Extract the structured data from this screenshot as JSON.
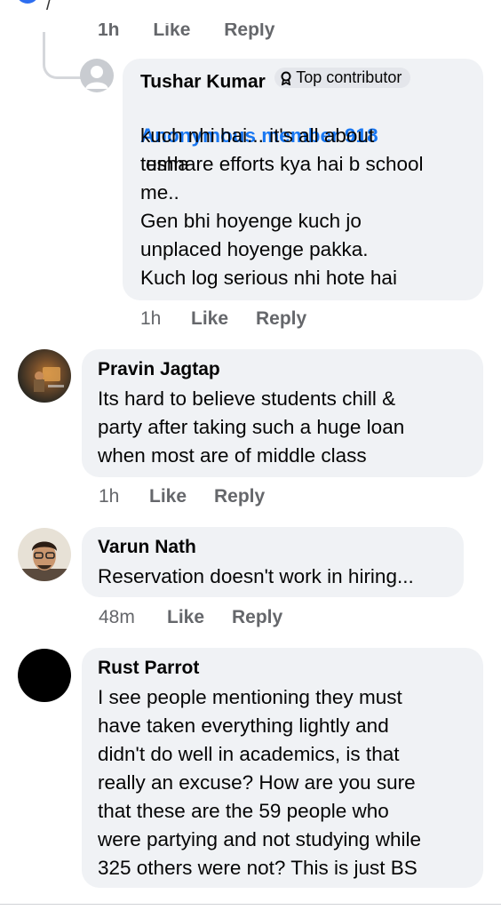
{
  "cutoff_actions": {
    "time": "1h",
    "like": "Like",
    "reply": "Reply"
  },
  "comments": [
    {
      "author": "Tushar Kumar",
      "badge": "Top contributor",
      "mention": "Anonymous member 918",
      "first_line_rest": "esha",
      "text": "kuch nhi hai... it's all about\ntumhare efforts kya hai b school\nme..\nGen bhi hoyenge kuch jo\nunplaced hoyenge pakka.\nKuch log serious nhi hote hai",
      "time": "1h",
      "like": "Like",
      "reply": "Reply"
    },
    {
      "author": "Pravin Jagtap",
      "text": "Its hard to believe students chill &\nparty after taking such a huge loan\nwhen most are of middle class",
      "time": "1h",
      "like": "Like",
      "reply": "Reply"
    },
    {
      "author": "Varun Nath",
      "text": "Reservation doesn't work in hiring...",
      "time": "48m",
      "like": "Like",
      "reply": "Reply"
    },
    {
      "author": "Rust Parrot",
      "text": "I see people mentioning they must\nhave taken everything lightly and\ndidn't do well in academics, is that\nreally an excuse? How are you sure\nthat these are the 59 people who\nwere partying and not studying while\n325 others were not? This is just BS",
      "time": "",
      "like": "",
      "reply": ""
    }
  ],
  "icons": {
    "badge": "contributor-badge-icon",
    "default_avatar": "default-user-avatar-icon"
  },
  "colors": {
    "bubble": "#f0f2f5",
    "mention": "#1877f2",
    "meta": "#65676b"
  }
}
